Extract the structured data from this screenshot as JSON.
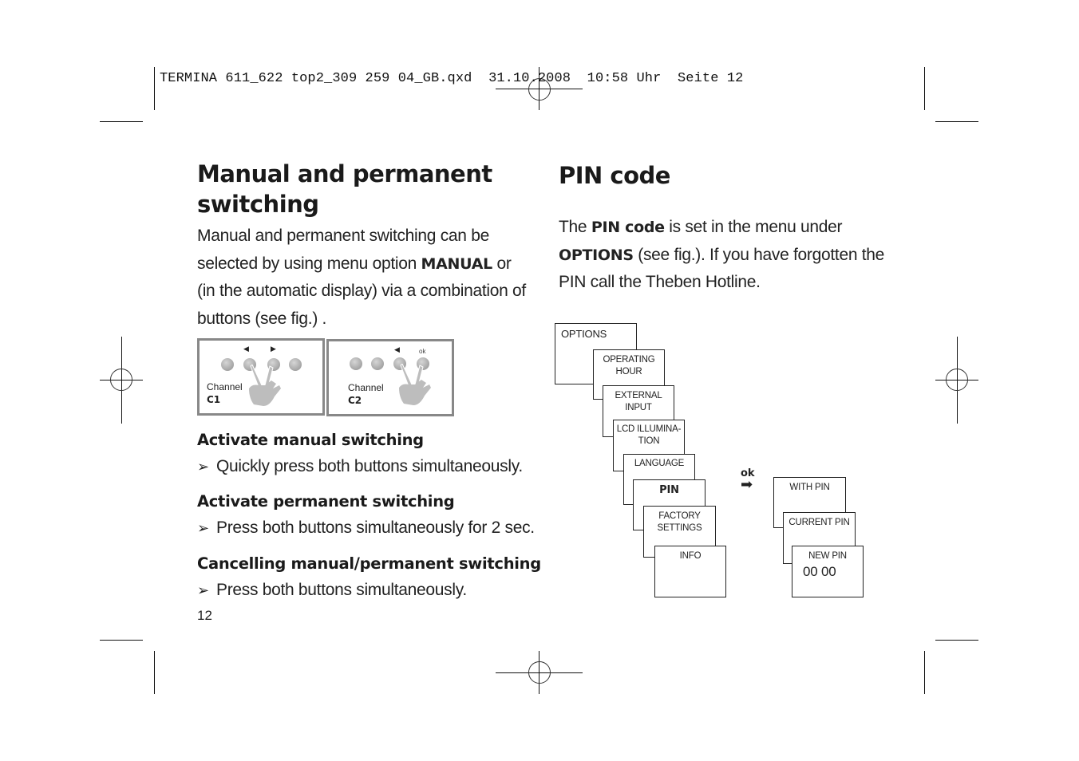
{
  "slug": "TERMINA 611_622 top2_309 259 04_GB.qxd  31.10.2008  10:58 Uhr  Seite 12",
  "left": {
    "title_line1": "Manual and permanent",
    "title_line2": "switching",
    "intro": [
      {
        "text": "Manual and permanent switching can be"
      },
      {
        "pre": "selected by using menu option ",
        "bold": "MANUAL",
        "post": " or"
      },
      {
        "text": "(in the automatic display) via a combination of"
      },
      {
        "text": "buttons (see fig.) ."
      }
    ],
    "figure": {
      "panels": [
        {
          "channel_label": "Channel",
          "channel_id": "C1",
          "marker_left": "◀",
          "marker_right": "▶"
        },
        {
          "channel_label": "Channel",
          "channel_id": "C2",
          "marker_left": "◀",
          "marker_right": "ok"
        }
      ]
    },
    "sections": [
      {
        "heading": "Activate manual switching",
        "bullet_icon": "➢",
        "bullet": "Quickly press both buttons simultaneously."
      },
      {
        "heading": "Activate permanent switching",
        "bullet_icon": "➢",
        "bullet": "Press both buttons simultaneously for 2 sec."
      },
      {
        "heading": "Cancelling manual/permanent switching",
        "bullet_icon": "➢",
        "bullet": "Press both buttons simultaneously."
      }
    ],
    "page_number": "12"
  },
  "right": {
    "title": "PIN code",
    "intro": {
      "line1_pre": "The ",
      "line1_bold": "PIN code",
      "line1_post": " is set in the menu under",
      "line2_bold": "OPTIONS",
      "line2_post": " (see fig.). If you have forgotten the",
      "line3": "PIN call the Theben Hotline."
    },
    "menu": {
      "options": "OPTIONS",
      "items": [
        "OPERATING HOUR",
        "EXTERNAL INPUT",
        "LCD ILLUMINA- TION",
        "LANGUAGE",
        "PIN",
        "FACTORY SETTINGS",
        "INFO"
      ],
      "operating_hour_l1": "OPERATING",
      "operating_hour_l2": "HOUR",
      "lcd_l1": "LCD ILLUMINA-",
      "lcd_l2": "TION",
      "factory_l1": "FACTORY",
      "factory_l2": "SETTINGS",
      "ok_label": "ok",
      "ok_arrow": "➡",
      "pin_submenu": [
        "WITH PIN",
        "CURRENT PIN",
        "NEW PIN"
      ],
      "new_pin_value": "00 00"
    }
  }
}
